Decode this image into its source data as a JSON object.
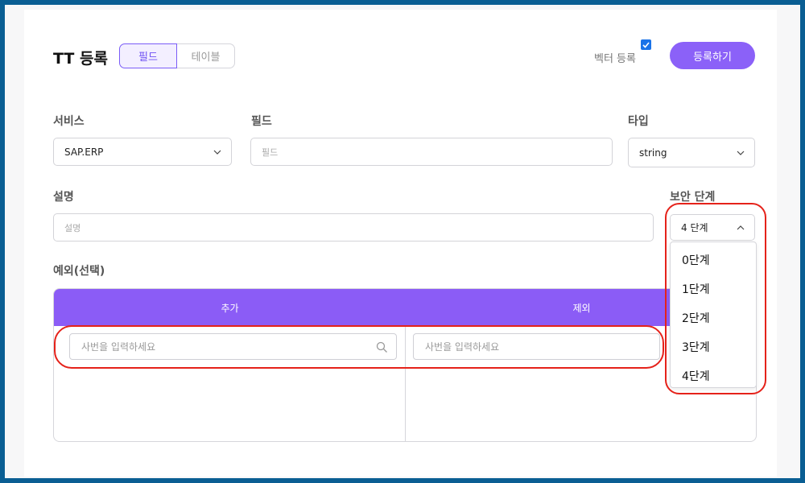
{
  "header": {
    "title": "TT 등록",
    "tabs": [
      {
        "label": "필드",
        "active": true
      },
      {
        "label": "테이블",
        "active": false
      }
    ],
    "vector_label": "벡터 등록",
    "vector_checked": true,
    "register_label": "등록하기"
  },
  "form": {
    "service": {
      "label": "서비스",
      "value": "SAP.ERP"
    },
    "field": {
      "label": "필드",
      "placeholder": "필드"
    },
    "type": {
      "label": "타입",
      "value": "string"
    },
    "description": {
      "label": "설명",
      "placeholder": "설명"
    },
    "security": {
      "label": "보안 단계",
      "value": "4 단계",
      "options": [
        "0단계",
        "1단계",
        "2단계",
        "3단계",
        "4단계"
      ]
    }
  },
  "exceptions": {
    "label": "예외(선택)",
    "add_header": "추가",
    "exclude_header": "제외",
    "add_search_placeholder": "사번을 입력하세요",
    "exclude_search_placeholder": "사번을 입력하세요"
  },
  "colors": {
    "accent": "#8b61f8",
    "table_header": "#8b5cf6",
    "annotation": "#e5221a",
    "frame": "#0a5e93"
  }
}
